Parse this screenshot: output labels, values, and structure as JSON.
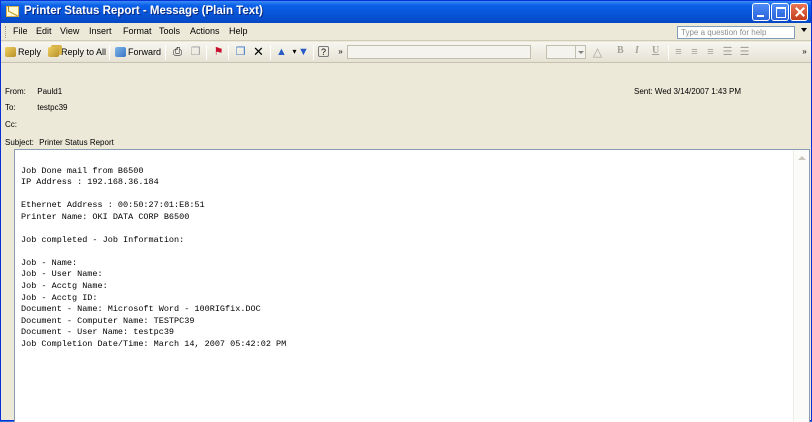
{
  "window": {
    "title": "Printer Status Report - Message (Plain Text)"
  },
  "menu": {
    "items": [
      "File",
      "Edit",
      "View",
      "Insert",
      "Format",
      "Tools",
      "Actions",
      "Help"
    ],
    "help_placeholder": "Type a question for help"
  },
  "toolbar": {
    "reply": "Reply",
    "reply_all": "Reply to All",
    "forward": "Forward",
    "icons": [
      "print-icon",
      "copy-icon",
      "flag-icon",
      "move-to-folder-icon",
      "delete-icon",
      "previous-item-icon",
      "next-item-icon",
      "help-icon",
      "toolbar-options-icon"
    ],
    "format_buttons": [
      "B",
      "I",
      "U"
    ]
  },
  "header": {
    "from_label": "From:",
    "from": "Pauld1",
    "to_label": "To:",
    "to": "testpc39",
    "cc_label": "Cc:",
    "cc": "",
    "subject_label": "Subject:",
    "subject": "Printer Status Report",
    "sent_label": "Sent:",
    "sent": "Wed 3/14/2007 1:43 PM"
  },
  "body": {
    "lines": [
      "Job Done mail from B6500",
      "IP Address : 192.168.36.184",
      "",
      "Ethernet Address : 00:50:27:01:E8:51",
      "Printer Name: OKI DATA CORP B6500",
      "",
      "Job completed - Job Information:",
      "",
      "Job - Name:",
      "Job - User Name:",
      "Job - Acctg Name:",
      "Job - Acctg ID:",
      "Document - Name: Microsoft Word - 100RIGfix.DOC",
      "Document - Computer Name: TESTPC39",
      "Document - User Name: testpc39",
      "Job Completion Date/Time: March 14, 2007 05:42:02 PM"
    ]
  }
}
